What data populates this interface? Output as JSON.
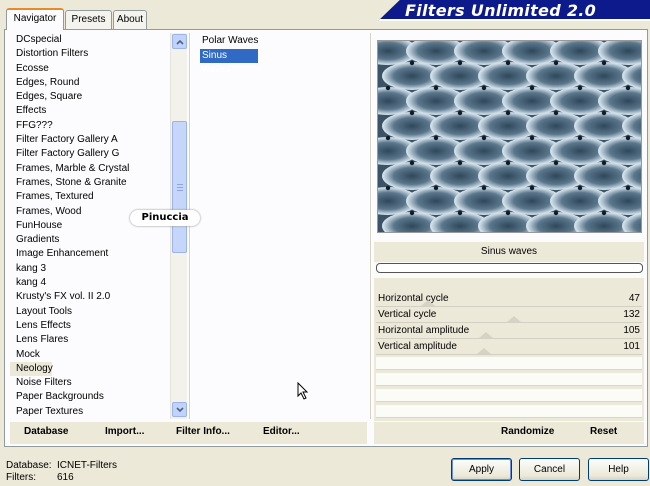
{
  "tabs": [
    {
      "label": "Navigator"
    },
    {
      "label": "Presets"
    },
    {
      "label": "About"
    }
  ],
  "app_title": "Filters Unlimited 2.0",
  "categories": [
    "DCspecial",
    "Distortion Filters",
    "Ecosse",
    "Edges, Round",
    "Edges, Square",
    "Effects",
    "FFG???",
    "Filter Factory Gallery A",
    "Filter Factory Gallery G",
    "Frames, Marble & Crystal",
    "Frames, Stone & Granite",
    "Frames, Textured",
    "Frames, Wood",
    "FunHouse",
    "Gradients",
    "Image Enhancement",
    "kang 3",
    "kang 4",
    "Krusty's FX vol. II 2.0",
    "Layout Tools",
    "Lens Effects",
    "Lens Flares",
    "Mock",
    "Neology",
    "Noise Filters",
    "Paper Backgrounds",
    "Paper Textures"
  ],
  "selected_category": "Neology",
  "filters": [
    "Polar Waves",
    "Sinus waves"
  ],
  "selected_filter": "Sinus waves",
  "watermark": "Pinuccia",
  "preview": {
    "filter_name": "Sinus waves"
  },
  "parameters": [
    {
      "name": "Horizontal cycle",
      "value": "47",
      "level": 0.18
    },
    {
      "name": "Vertical cycle",
      "value": "132",
      "level": 0.52
    },
    {
      "name": "Horizontal amplitude",
      "value": "105",
      "level": 0.41
    },
    {
      "name": "Vertical amplitude",
      "value": "101",
      "level": 0.4
    }
  ],
  "left_buttons": {
    "database": "Database",
    "import": "Import...",
    "filter_info": "Filter Info...",
    "editor": "Editor..."
  },
  "right_buttons": {
    "randomize": "Randomize",
    "reset": "Reset"
  },
  "footer": {
    "database_label": "Database:",
    "database_value": "ICNET-Filters",
    "filters_label": "Filters:",
    "filters_value": "616"
  },
  "dialog_buttons": {
    "apply": "Apply",
    "cancel": "Cancel",
    "help": "Help"
  },
  "colors": {
    "banner": "#0c1a8c",
    "selection": "#316ac5",
    "preview_dark": "#3b5366",
    "preview_light": "#eef4f8"
  }
}
